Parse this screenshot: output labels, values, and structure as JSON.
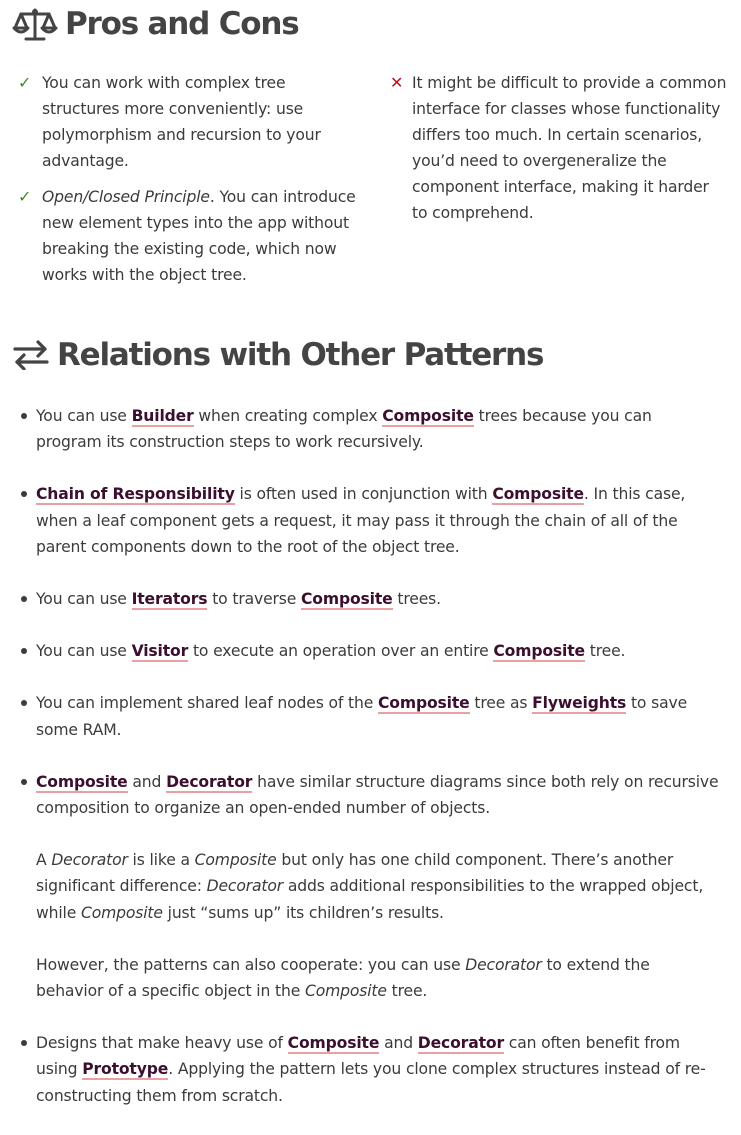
{
  "pros_cons": {
    "title": "Pros and Cons",
    "icon": "balance-scale-icon",
    "pros": [
      {
        "marker": "✓",
        "text": "You can work with complex tree structures more conveniently: use polymorphism and recursion to your advantage."
      },
      {
        "marker": "✓",
        "emph": "Open/Closed Principle",
        "text": ". You can introduce new element types into the app without breaking the existing code, which now works with the object tree."
      }
    ],
    "cons": [
      {
        "marker": "✕",
        "text": "It might be difficult to provide a common interface for classes whose functionality differs too much. In certain scenarios, you’d need to overgeneralize the component interface, making it harder to comprehend."
      }
    ]
  },
  "relations": {
    "title": "Relations with Other Patterns",
    "icon": "swap-arrows-icon"
  },
  "links": {
    "builder": "Builder",
    "composite": "Composite",
    "chain": "Chain of Responsibility",
    "iterators": "Iterators",
    "visitor": "Visitor",
    "flyweights": "Flyweights",
    "decorator": "Decorator",
    "prototype": "Prototype"
  },
  "words": {
    "decorator": "Decorator",
    "composite": "Composite"
  },
  "items": {
    "i1": {
      "t1": "You can use ",
      "t2": " when creating complex ",
      "t3": " trees because you can program its construction steps to work recursively."
    },
    "i2": {
      "t1": " is often used in conjunction with ",
      "t2": ". In this case, when a leaf component gets a request, it may pass it through the chain of all of the parent components down to the root of the object tree."
    },
    "i3": {
      "t1": "You can use ",
      "t2": " to traverse ",
      "t3": " trees."
    },
    "i4": {
      "t1": "You can use ",
      "t2": " to execute an operation over an entire ",
      "t3": " tree."
    },
    "i5": {
      "t1": "You can implement shared leaf nodes of the ",
      "t2": " tree as ",
      "t3": " to save some RAM."
    },
    "i6": {
      "t1": " and ",
      "t2": " have similar structure diagrams since both rely on recursive composition to organize an open-ended number of objects.",
      "p2a": "A ",
      "p2b": " is like a ",
      "p2c": " but only has one child component. There’s another significant difference: ",
      "p2d": " adds additional responsibilities to the wrapped object, while ",
      "p2e": " just “sums up” its children’s results.",
      "p3a": "However, the patterns can also cooperate: you can use ",
      "p3b": " to extend the behavior of a specific object in the ",
      "p3c": " tree."
    },
    "i7": {
      "t1": "Designs that make heavy use of ",
      "t2": " and ",
      "t3": " can often benefit from using ",
      "t4": ". Applying the pattern lets you clone complex structures instead of re-constructing them from scratch."
    }
  }
}
